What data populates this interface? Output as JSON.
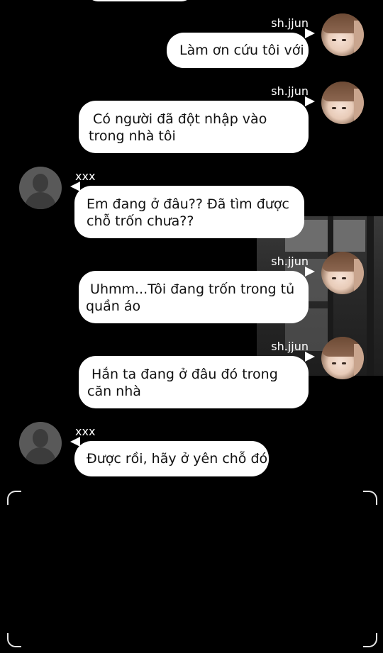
{
  "chat": {
    "messages": [
      {
        "sender": "sh.jjun",
        "text": "Làm ơn cứu tôi với",
        "side": "right",
        "avatar": "user-photo-avatar"
      },
      {
        "sender": "sh.jjun",
        "text": " Có người đã đột nhập vào trong nhà tôi",
        "side": "right",
        "avatar": "user-photo-avatar"
      },
      {
        "sender": "xxx",
        "text": "Em đang ở đâu?? Đã tìm được chỗ trốn chưa??",
        "side": "left",
        "avatar": "default-person-avatar"
      },
      {
        "sender": "sh.jjun",
        "text": " Uhmm...Tôi đang trốn trong tủ quần áo",
        "side": "right",
        "avatar": "user-photo-avatar"
      },
      {
        "sender": "sh.jjun",
        "text": " Hắn ta đang ở đâu đó trong căn nhà",
        "side": "right",
        "avatar": "user-photo-avatar"
      },
      {
        "sender": "xxx",
        "text": "Được rồi, hãy ở yên chỗ đó",
        "side": "left",
        "avatar": "default-person-avatar"
      }
    ]
  },
  "colors": {
    "background": "#000000",
    "bubble": "#ffffff",
    "name_text": "#ffffff"
  }
}
